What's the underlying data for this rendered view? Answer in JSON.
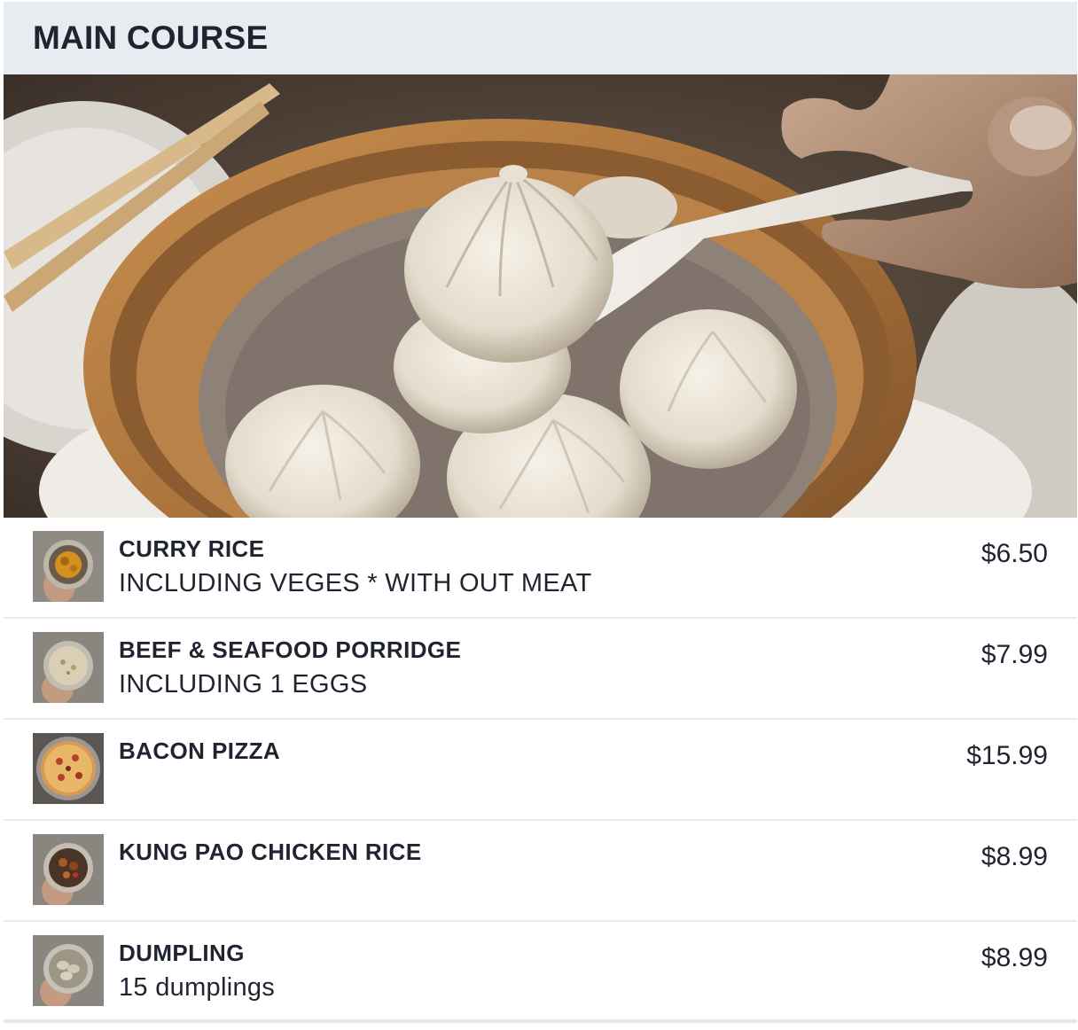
{
  "section": {
    "title": "MAIN COURSE"
  },
  "hero": {
    "image_description": "xiaolongbao-on-spoon"
  },
  "items": [
    {
      "name": "CURRY RICE",
      "description": "INCLUDING VEGES * WITH OUT MEAT",
      "price": "$6.50",
      "thumb_icon": "curry-rice-photo"
    },
    {
      "name": "BEEF & SEAFOOD PORRIDGE",
      "description": "INCLUDING 1 EGGS",
      "price": "$7.99",
      "thumb_icon": "porridge-photo"
    },
    {
      "name": "BACON PIZZA",
      "description": "",
      "price": "$15.99",
      "thumb_icon": "pizza-photo"
    },
    {
      "name": "KUNG PAO CHICKEN RICE",
      "description": "",
      "price": "$8.99",
      "thumb_icon": "kung-pao-photo"
    },
    {
      "name": "DUMPLING",
      "description": "15 dumplings",
      "price": "$8.99",
      "thumb_icon": "dumpling-photo"
    }
  ],
  "colors": {
    "header_bg": "#e8ebf0",
    "text": "#1f2430",
    "divider": "#e6e8eb"
  }
}
